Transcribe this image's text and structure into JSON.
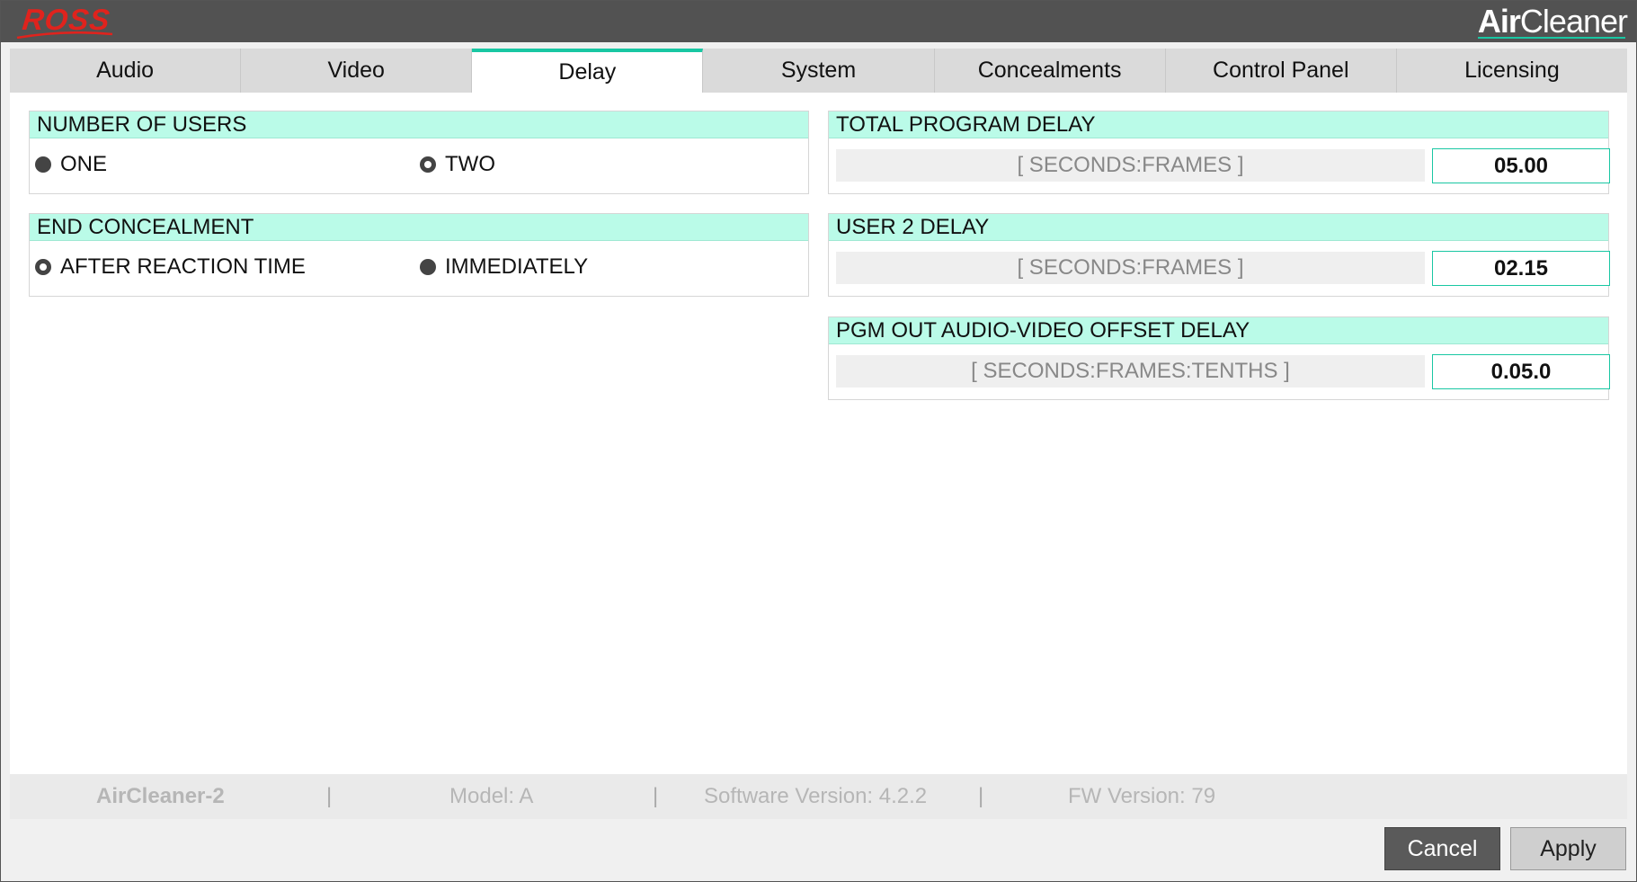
{
  "titlebar": {
    "logo_text": "ROSS",
    "brand_bold": "Air",
    "brand_light": "Cleaner"
  },
  "tabs": [
    {
      "label": "Audio"
    },
    {
      "label": "Video"
    },
    {
      "label": "Delay",
      "active": true
    },
    {
      "label": "System"
    },
    {
      "label": "Concealments"
    },
    {
      "label": "Control Panel"
    },
    {
      "label": "Licensing"
    }
  ],
  "users_panel": {
    "title": "NUMBER OF USERS",
    "options": [
      {
        "label": "ONE",
        "selected": false
      },
      {
        "label": "TWO",
        "selected": true
      }
    ]
  },
  "end_panel": {
    "title": "END CONCEALMENT",
    "options": [
      {
        "label": "AFTER REACTION TIME",
        "selected": true
      },
      {
        "label": "IMMEDIATELY",
        "selected": false
      }
    ]
  },
  "total_delay": {
    "title": "TOTAL PROGRAM DELAY",
    "unit": "[ SECONDS:FRAMES ]",
    "value": "05.00"
  },
  "user2_delay": {
    "title": "USER 2 DELAY",
    "unit": "[ SECONDS:FRAMES ]",
    "value": "02.15"
  },
  "av_offset": {
    "title": "PGM OUT AUDIO-VIDEO OFFSET DELAY",
    "unit": "[ SECONDS:FRAMES:TENTHS ]",
    "value": "0.05.0"
  },
  "status": {
    "device": "AirCleaner-2",
    "model": "Model: A",
    "software": "Software Version: 4.2.2",
    "firmware": "FW Version: 79",
    "separator": "|"
  },
  "buttons": {
    "cancel": "Cancel",
    "apply": "Apply"
  },
  "colors": {
    "accent": "#19c7a3",
    "header_bg": "#bafbe8",
    "logo_red": "#e0231d",
    "titlebar": "#525252"
  }
}
